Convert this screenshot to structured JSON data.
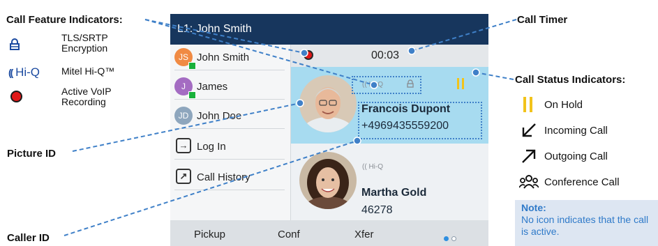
{
  "legend": {
    "title": "Call Feature Indicators:",
    "items": [
      {
        "icon": "lock-icon",
        "label": "TLS/SRTP Encryption"
      },
      {
        "icon": "hiq-icon",
        "mark": "Hi-Q",
        "label": "Mitel Hi-Q™"
      },
      {
        "icon": "record-icon",
        "label": "Active VoIP Recording"
      }
    ]
  },
  "callouts": {
    "picture_id": "Picture ID",
    "caller_id": "Caller ID",
    "call_timer": "Call Timer"
  },
  "phone": {
    "title": "L1: John Smith",
    "contacts": [
      {
        "initials": "JS",
        "name": "John Smith",
        "color": "#f08a43",
        "presence": true
      },
      {
        "initials": "J",
        "name": "James",
        "color": "#a46cc2",
        "presence": true
      },
      {
        "initials": "JD",
        "name": "John Doe",
        "color": "#8ea6bd",
        "presence": false
      }
    ],
    "actions": [
      {
        "icon": "login-icon",
        "label": "Log In"
      },
      {
        "icon": "call-history-icon",
        "label": "Call History"
      }
    ],
    "timer": "00:03",
    "calls": [
      {
        "hiq": "Hi-Q",
        "name": "Francois Dupont",
        "number": "+4969435559200",
        "state": "on-hold"
      },
      {
        "hiq": "Hi-Q",
        "name": "Martha Gold",
        "number": "46278",
        "state": "active"
      }
    ],
    "softkeys": [
      "Pickup",
      "Conf",
      "Xfer"
    ]
  },
  "status": {
    "title": "Call Status Indicators:",
    "items": [
      {
        "icon": "hold-icon",
        "label": "On Hold"
      },
      {
        "icon": "incoming-call-icon",
        "label": "Incoming Call"
      },
      {
        "icon": "outgoing-call-icon",
        "label": "Outgoing Call"
      },
      {
        "icon": "conference-call-icon",
        "label": "Conference Call"
      }
    ],
    "note_title": "Note:",
    "note_text": "No icon indicates that the call is active."
  },
  "colors": {
    "titlebar": "#17365d",
    "active_call": "#a7dbf0",
    "accent": "#3f80c8",
    "hold": "#f2c31b",
    "record": "#e01818"
  }
}
